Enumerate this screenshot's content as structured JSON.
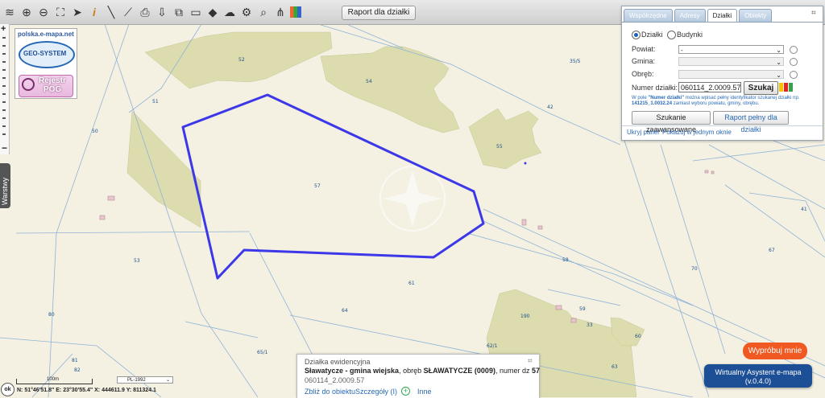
{
  "toolbar": {
    "icons": [
      "layers-icon",
      "zoom-in-icon",
      "zoom-out-icon",
      "zoom-extent-icon",
      "pointer-icon",
      "info-icon",
      "measure-distance-icon",
      "measure-area-icon",
      "print-icon",
      "download-icon",
      "copy-icon",
      "comment-icon",
      "shape-icon",
      "cloud-upload-icon",
      "settings-icon",
      "search-map-icon",
      "route-icon",
      "color-palette-icon"
    ],
    "report_button": "Raport dla działki"
  },
  "logos": {
    "site": "polska.e-mapa.net",
    "geosystem": "GEO-SYSTEM",
    "rejestr_line1": "Rejestr",
    "rejestr_line2": "POG"
  },
  "layers_tab": "Warstwy",
  "panel": {
    "tabs": [
      "Współrzędne",
      "Adresy",
      "Działki",
      "Obiekty"
    ],
    "active_tab": "Działki",
    "radio_dzialki": "Działki",
    "radio_budynki": "Budynki",
    "powiat_label": "Powiat:",
    "powiat_value": "-",
    "gmina_label": "Gmina:",
    "obreb_label": "Obręb:",
    "numer_label": "Numer działki:",
    "numer_value": "060114_2.0009.57",
    "search_button": "Szukaj",
    "hint_bold1": "\"Numer działki\"",
    "hint_pre": "W pole ",
    "hint_mid": " można wpisać pełny identyfikator szukanej działki np. ",
    "hint_bold2": "141215_1.0032.24",
    "hint_post": " zamiast wyboru powiatu, gminy, obrębu.",
    "advanced_button": "Szukanie zaawansowane",
    "full_report_button": "Raport pełny dla działki",
    "hide_panel": "Ukryj panel",
    "show_one_window": "Pokazuj w jednym oknie",
    "colors": [
      "#f5c400",
      "#e8231b",
      "#3aa14a"
    ]
  },
  "info": {
    "title": "Działka ewidencyjna",
    "place_bold": "Sławatycze - gmina wiejska",
    "sep1": ", obręb ",
    "obreb_bold": "SŁAWATYCZE (0009)",
    "sep2": ", numer dz ",
    "number_bold": "57",
    "identifier": "060114_2.0009.57",
    "zoom_link": "Zbliż do obiektu",
    "details_link": "Szczegóły (I)",
    "other_link": "Inne"
  },
  "map": {
    "parcel_labels": [
      {
        "text": "52"
      },
      {
        "text": "35/5"
      },
      {
        "text": "54"
      },
      {
        "text": "51"
      },
      {
        "text": "42"
      },
      {
        "text": "50"
      },
      {
        "text": "55"
      },
      {
        "text": "57"
      },
      {
        "text": "41"
      },
      {
        "text": "53"
      },
      {
        "text": "58"
      },
      {
        "text": "67"
      },
      {
        "text": "70"
      },
      {
        "text": "61"
      },
      {
        "text": "64"
      },
      {
        "text": "59"
      },
      {
        "text": "190"
      },
      {
        "text": "33"
      },
      {
        "text": "80"
      },
      {
        "text": "60"
      },
      {
        "text": "62/1"
      },
      {
        "text": "65/1"
      },
      {
        "text": "81"
      },
      {
        "text": "82"
      },
      {
        "text": "63"
      }
    ]
  },
  "scale": {
    "label": "100m",
    "projection": "PL-1992"
  },
  "coords": "N: 51°46'51.8\"  E: 23°30'55.4\"  X: 444611.9  Y: 811324.1",
  "ok_label": "ok",
  "assistant": {
    "try_label": "Wypróbuj mnie",
    "title": "Wirtualny Asystent e-mapa",
    "version": "(v.0.4.0)"
  }
}
